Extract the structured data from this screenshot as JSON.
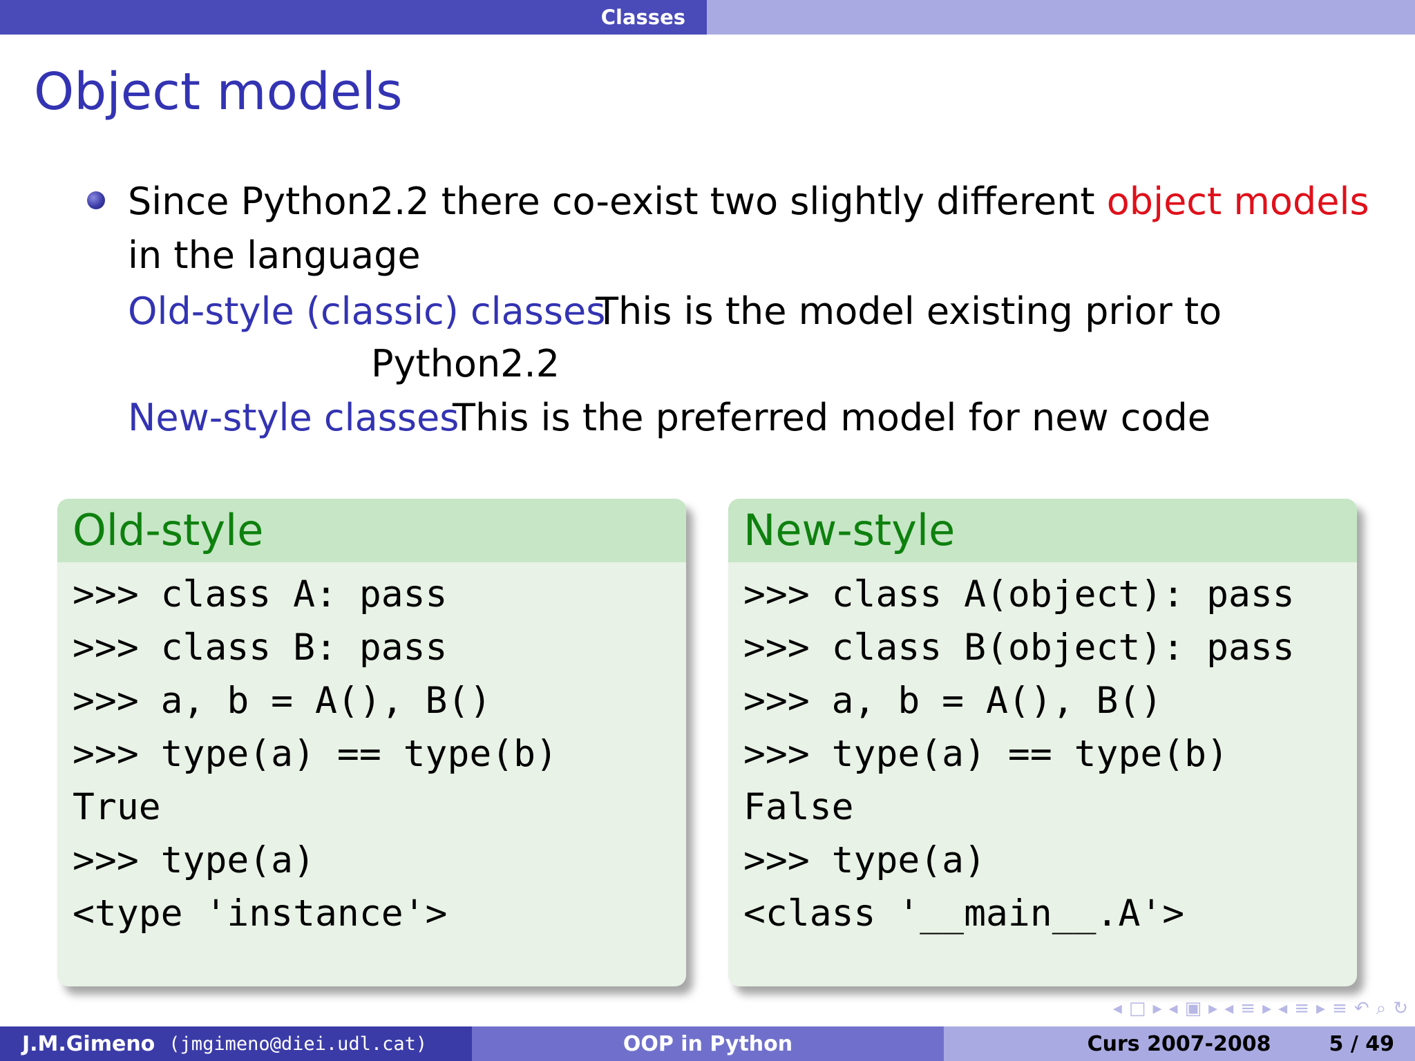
{
  "header": {
    "section": "Classes"
  },
  "title": "Object models",
  "bullet": {
    "text_before": "Since Python2.2 there co-exist two slightly different ",
    "highlight": "object models",
    "text_after": " in the language"
  },
  "definitions": [
    {
      "term": "Old-style (classic) classes",
      "desc_line1": "This is the model existing prior to",
      "desc_line2": "Python2.2"
    },
    {
      "term": "New-style classes",
      "desc": "This is the preferred model for new code"
    }
  ],
  "blocks": {
    "old": {
      "title": "Old-style",
      "code": ">>> class A: pass\n>>> class B: pass\n>>> a, b = A(), B()\n>>> type(a) == type(b)\nTrue\n>>> type(a)\n<type 'instance'>"
    },
    "new": {
      "title": "New-style",
      "code": ">>> class A(object): pass\n>>> class B(object): pass\n>>> a, b = A(), B()\n>>> type(a) == type(b)\nFalse\n>>> type(a)\n<class '__main__.A'>"
    }
  },
  "footer": {
    "author": "J.M.Gimeno",
    "email": "(jmgimeno@diei.udl.cat)",
    "talk": "OOP in Python",
    "course": "Curs 2007-2008",
    "page": "5 / 49"
  },
  "nav_icons": [
    "nav-prev-icon",
    "nav-frame-icon",
    "nav-next-icon",
    "nav-subsection-icon",
    "nav-section-icon",
    "nav-search-icon",
    "nav-back-icon"
  ],
  "colors": {
    "theme_dark": "#3b3ba8",
    "theme_mid": "#7070cc",
    "theme_light": "#aaaae3",
    "title": "#3333b3",
    "alert": "#e0101a",
    "block_title": "#0e800e",
    "block_title_bg": "#c6e6c6",
    "block_body_bg": "#e8f2e6"
  }
}
